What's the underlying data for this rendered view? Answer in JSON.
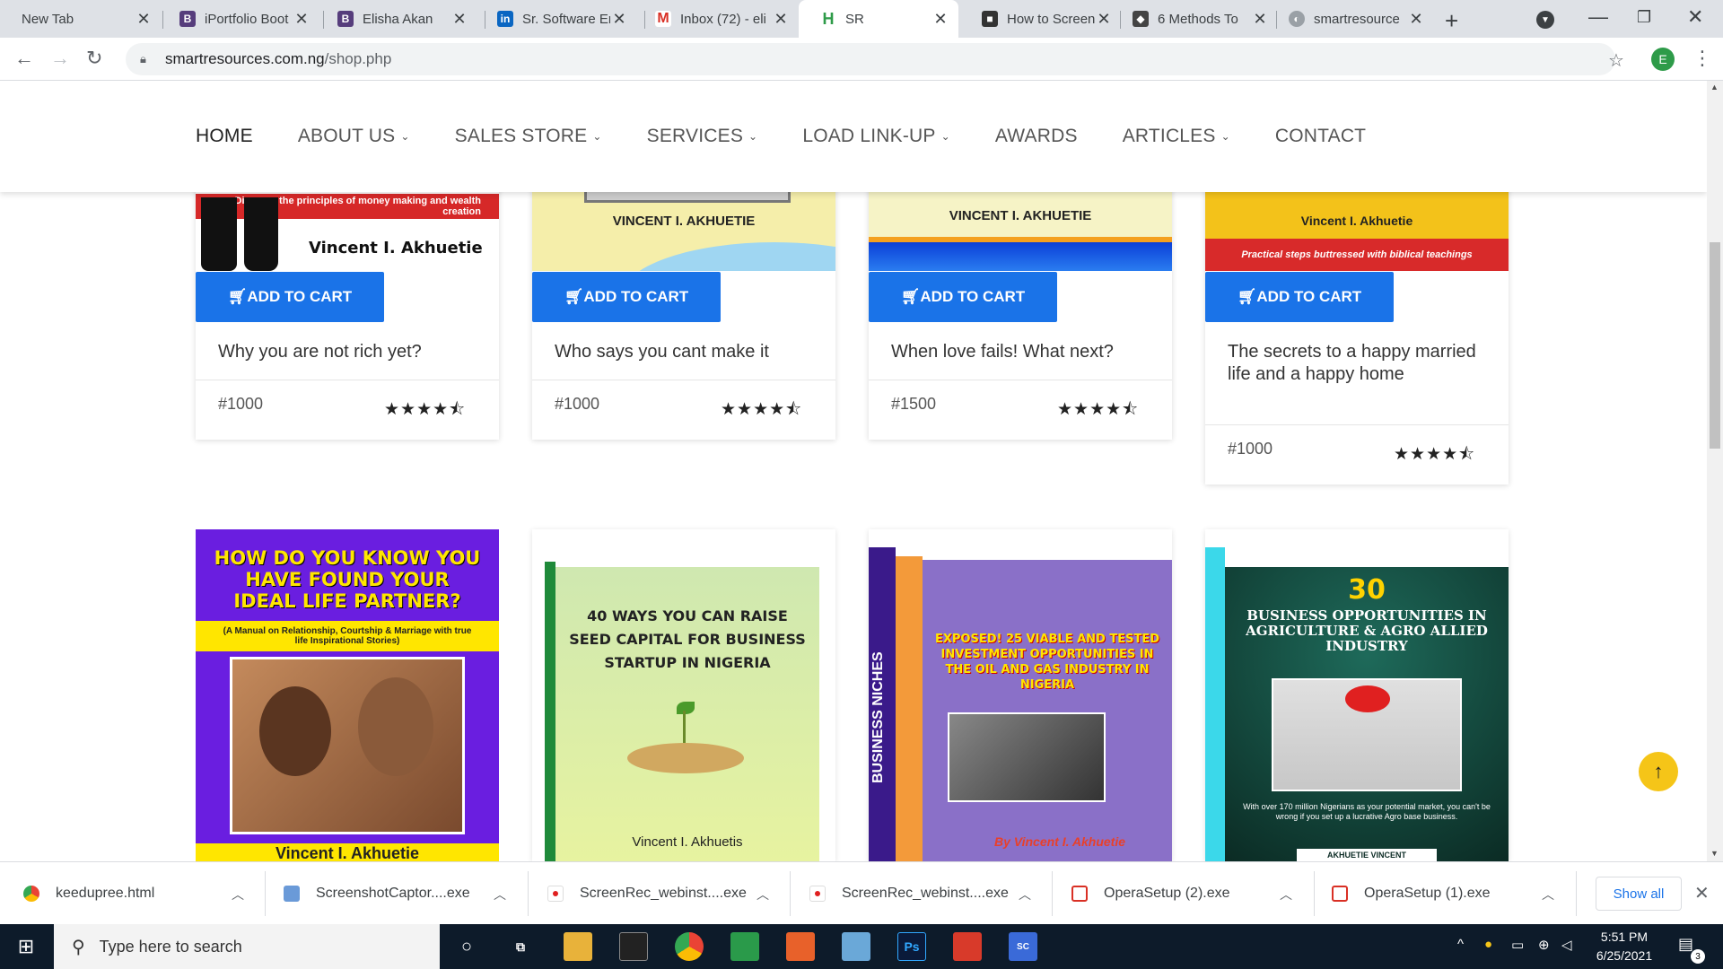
{
  "browser": {
    "tabs": [
      {
        "label": "New Tab",
        "icon": "none"
      },
      {
        "label": "iPortfolio Boot",
        "icon": "bootstrap-icon",
        "color": "#563d7c"
      },
      {
        "label": "Elisha Akan",
        "icon": "bootstrap-icon",
        "color": "#563d7c"
      },
      {
        "label": "Sr. Software Er",
        "icon": "linkedin-icon",
        "color": "#0a66c2"
      },
      {
        "label": "Inbox (72) - eli",
        "icon": "gmail-icon",
        "color": "#d93025"
      },
      {
        "label": "SR",
        "icon": "site-icon",
        "color": "#2e9b49"
      },
      {
        "label": "How to Screen",
        "icon": "screenrec-icon",
        "color": "#333333"
      },
      {
        "label": "6 Methods To",
        "icon": "page-icon",
        "color": "#444444"
      },
      {
        "label": "smartresource",
        "icon": "globe-icon",
        "color": "#5f6368"
      }
    ],
    "url_host": "smartresources.com.ng",
    "url_path": "/shop.php",
    "profile_initial": "E"
  },
  "site_nav": {
    "items": [
      {
        "label": "HOME",
        "dropdown": false
      },
      {
        "label": "ABOUT US",
        "dropdown": true
      },
      {
        "label": "SALES STORE",
        "dropdown": true
      },
      {
        "label": "SERVICES",
        "dropdown": true
      },
      {
        "label": "LOAD LINK-UP",
        "dropdown": true
      },
      {
        "label": "AWARDS",
        "dropdown": false
      },
      {
        "label": "ARTICLES",
        "dropdown": true
      },
      {
        "label": "CONTACT",
        "dropdown": false
      }
    ]
  },
  "products_row1": [
    {
      "cover_text_top": "Discover the principles of money making and wealth creation",
      "cover_author": "Vincent I. Akhuetie",
      "cart_label": "ADD TO CART",
      "title": "Why you are not rich yet?",
      "price": "#1000",
      "rating": "4.5"
    },
    {
      "cover_author": "VINCENT I. AKHUETIE",
      "cart_label": "ADD TO CART",
      "title": "Who says you cant make it",
      "price": "#1000",
      "rating": "4.5"
    },
    {
      "cover_author": "VINCENT I. AKHUETIE",
      "cart_label": "ADD TO CART",
      "title": "When love fails! What next?",
      "price": "#1500",
      "rating": "4.5"
    },
    {
      "cover_author": "Vincent I. Akhuetie",
      "cover_text_bottom": "Practical steps buttressed with biblical teachings",
      "cart_label": "ADD TO CART",
      "title": "The secrets to a happy married life and a happy home",
      "price": "#1000",
      "rating": "4.5"
    }
  ],
  "products_row2": [
    {
      "cover_title": "HOW DO YOU KNOW YOU HAVE FOUND YOUR IDEAL LIFE PARTNER?",
      "cover_sub": "(A Manual on Relationship, Courtship & Marriage with true life Inspirational Stories)",
      "cover_author": "Vincent I. Akhuetie"
    },
    {
      "cover_title": "40 WAYS YOU CAN RAISE SEED CAPITAL FOR BUSINESS STARTUP IN NIGERIA",
      "cover_author": "Vincent I. Akhuetis"
    },
    {
      "cover_spine": "BUSINESS NICHES",
      "cover_title": "EXPOSED! 25 VIABLE AND TESTED INVESTMENT OPPORTUNITIES IN THE OIL AND GAS INDUSTRY IN NIGERIA",
      "cover_author": "By Vincent I. Akhuetie"
    },
    {
      "cover_number": "30",
      "cover_title": "BUSINESS OPPORTUNITIES IN AGRICULTURE & AGRO ALLIED INDUSTRY",
      "cover_sub": "With over 170 million Nigerians as your potential market, you can't be wrong if you set up a lucrative Agro base business.",
      "cover_author": "AKHUETIE VINCENT"
    }
  ],
  "downloads": {
    "items": [
      {
        "name": "keedupree.html",
        "icon": "chrome-icon"
      },
      {
        "name": "ScreenshotCaptor....exe",
        "icon": "screenshotcaptor-icon"
      },
      {
        "name": "ScreenRec_webinst....exe",
        "icon": "screenrec-icon"
      },
      {
        "name": "ScreenRec_webinst....exe",
        "icon": "screenrec-icon"
      },
      {
        "name": "OperaSetup (2).exe",
        "icon": "opera-installer-icon"
      },
      {
        "name": "OperaSetup (1).exe",
        "icon": "opera-installer-icon"
      }
    ],
    "show_all": "Show all"
  },
  "taskbar": {
    "search_placeholder": "Type here to search",
    "time": "5:51 PM",
    "date": "6/25/2021",
    "notification_count": "3"
  }
}
